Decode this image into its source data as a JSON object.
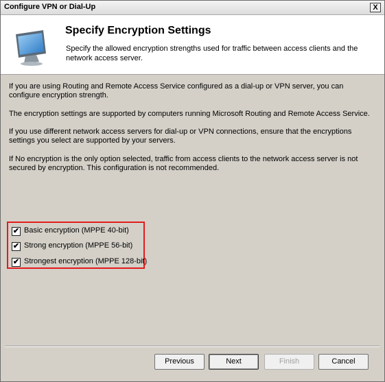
{
  "window": {
    "title": "Configure VPN or Dial-Up",
    "close_label": "X"
  },
  "header": {
    "title": "Specify Encryption Settings",
    "description": "Specify the allowed encryption strengths used for traffic between access clients and the network access server.",
    "icon": "monitor-icon"
  },
  "body": {
    "paragraphs": [
      "If you are using Routing and Remote Access Service configured as a dial-up or VPN server, you can configure encryption strength.",
      "The encryption settings are supported by computers running Microsoft Routing and Remote Access Service.",
      "If you use different network access servers for dial-up or VPN connections, ensure that the encryptions settings you select are supported by your servers.",
      "If No encryption is the only option selected, traffic from access clients to the network access server is not secured by encryption. This configuration is not recommended."
    ]
  },
  "options": [
    {
      "label": "Basic encryption (MPPE 40-bit)",
      "checked": true
    },
    {
      "label": "Strong encryption (MPPE 56-bit)",
      "checked": true
    },
    {
      "label": "Strongest encryption (MPPE 128-bit)",
      "checked": true
    }
  ],
  "buttons": {
    "previous": "Previous",
    "next": "Next",
    "finish": "Finish",
    "cancel": "Cancel"
  },
  "colors": {
    "highlight_border": "#e21b1b",
    "dialog_background": "#d4d0c8"
  }
}
